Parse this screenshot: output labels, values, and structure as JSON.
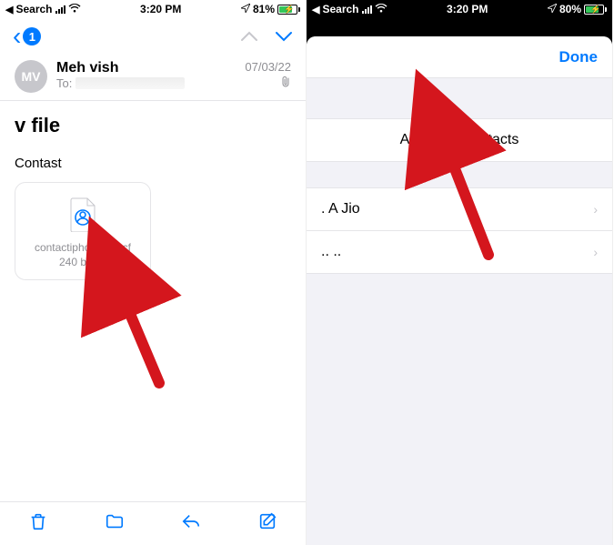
{
  "left": {
    "statusbar": {
      "back_label": "Search",
      "time": "3:20 PM",
      "battery_pct": "81%"
    },
    "nav": {
      "badge": "1"
    },
    "message": {
      "avatar_initials": "MV",
      "sender": "Meh vish",
      "to_label": "To:",
      "date": "07/03/22",
      "subject": "v file",
      "body_label": "Contast",
      "attachment": {
        "filename": "contactiphone2s.vcf",
        "size": "240 bytes"
      }
    }
  },
  "right": {
    "statusbar": {
      "back_label": "Search",
      "time": "3:20 PM",
      "battery_pct": "80%"
    },
    "sheet": {
      "done_label": "Done",
      "add_all_label": "Add All 2 Contacts",
      "contacts": [
        {
          "name": ". A Jio"
        },
        {
          "name": ".. .."
        }
      ]
    }
  },
  "colors": {
    "accent": "#007aff",
    "green": "#34c759",
    "red": "#d4161d"
  }
}
